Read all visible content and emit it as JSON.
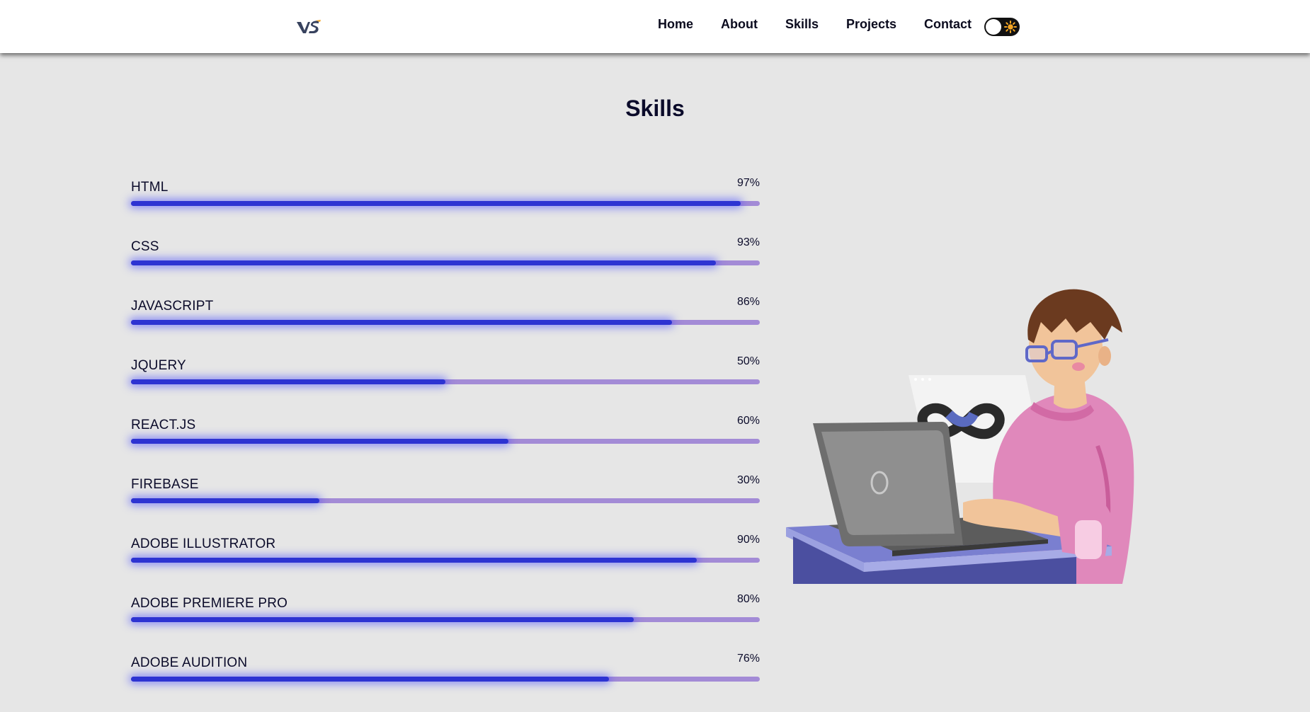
{
  "navbar": {
    "logo_text": "VS",
    "links": [
      {
        "label": "Home"
      },
      {
        "label": "About"
      },
      {
        "label": "Skills"
      },
      {
        "label": "Projects"
      },
      {
        "label": "Contact"
      }
    ],
    "theme_toggle_icon": "sun-icon"
  },
  "page": {
    "title": "Skills"
  },
  "colors": {
    "background": "#e6e6e6",
    "bar_fill": "#2d33d2",
    "bar_track": "#a38bd6",
    "toggle_sun": "#f5a623"
  },
  "skills": [
    {
      "name": "HTML",
      "percent": "97%",
      "value": 97
    },
    {
      "name": "CSS",
      "percent": "93%",
      "value": 93
    },
    {
      "name": "JAVASCRIPT",
      "percent": "86%",
      "value": 86
    },
    {
      "name": "JQUERY",
      "percent": "50%",
      "value": 50
    },
    {
      "name": "REACT.JS",
      "percent": "60%",
      "value": 60
    },
    {
      "name": "FIREBASE",
      "percent": "30%",
      "value": 30
    },
    {
      "name": "ADOBE ILLUSTRATOR",
      "percent": "90%",
      "value": 90
    },
    {
      "name": "ADOBE PREMIERE PRO",
      "percent": "80%",
      "value": 80
    },
    {
      "name": "ADOBE AUDITION",
      "percent": "76%",
      "value": 76
    }
  ]
}
